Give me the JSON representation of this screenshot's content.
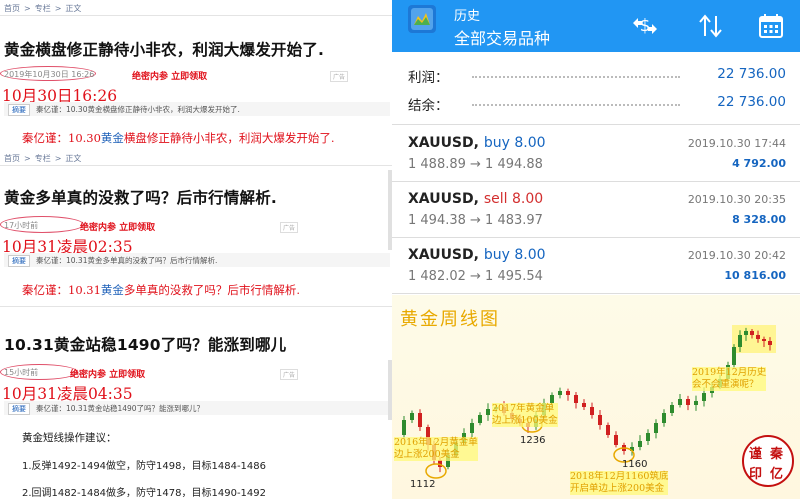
{
  "left": {
    "breadcrumb": [
      "首页",
      ">",
      "专栏",
      ">",
      "正文"
    ],
    "promo": "绝密内参 立即领取",
    "ad_label": "广告",
    "summary_tag": "摘要",
    "articles": [
      {
        "title": "黄金横盘修正静待小非农，利润大爆发开始了.",
        "time": "2019年10月30日 16:26",
        "bigtime": "10月30日16:26",
        "summary": "秦亿谨：10.30黄金横盘修正静待小非农，利润大爆发开始了.",
        "quote_pre": "秦亿谨：10.30",
        "quote_gold": "黄金",
        "quote_post": "横盘修正静待小非农，利润大爆发开始了."
      },
      {
        "title": "黄金多单真的没救了吗？后市行情解析.",
        "time": "17小时前",
        "bigtime": "10月31凌晨02:35",
        "summary": "秦亿谨：10.31黄金多单真的没救了吗？后市行情解析.",
        "quote_pre": "秦亿谨：10.31",
        "quote_gold": "黄金",
        "quote_post": "多单真的没救了吗？后市行情解析."
      },
      {
        "title": "10.31黄金站稳1490了吗？能涨到哪儿",
        "time": "15小时前",
        "bigtime": "10月31凌晨04:35",
        "summary": "秦亿谨：10.31黄金站稳1490了吗？能涨到哪儿？"
      }
    ],
    "advice_title": "黄金短线操作建议：",
    "advice_items": [
      "1.反弹1492-1494做空，防守1498，目标1484-1486",
      "2.回调1482-1484做多，防守1478，目标1490-1492"
    ]
  },
  "right": {
    "appbar": {
      "title": "历史",
      "subtitle": "全部交易品种",
      "icons": [
        "currency-filter-icon",
        "sort-icon",
        "calendar-icon"
      ]
    },
    "summary": {
      "profit_label": "利润：",
      "profit_value": "22 736.00",
      "balance_label": "结余：",
      "balance_value": "22 736.00"
    },
    "trades": [
      {
        "symbol": "XAUUSD,",
        "side": "buy 8.00",
        "prices": "1 488.89 → 1 494.88",
        "time": "2019.10.30 17:44",
        "profit": "4 792.00"
      },
      {
        "symbol": "XAUUSD,",
        "side": "sell 8.00",
        "prices": "1 494.38 → 1 483.97",
        "time": "2019.10.30 20:35",
        "profit": "8 328.00"
      },
      {
        "symbol": "XAUUSD,",
        "side": "buy 8.00",
        "prices": "1 482.02 → 1 495.54",
        "time": "2019.10.30 20:42",
        "profit": "10 816.00"
      }
    ],
    "chart": {
      "title": "黄金周线图",
      "annotations": {
        "a2016": [
          "2016年12月黄金单",
          "边上涨200美金"
        ],
        "a2017": [
          "2017年黄金单",
          "边上涨100美金"
        ],
        "a2018": [
          "2018年12月1160筑底",
          "开启单边上涨200美金"
        ],
        "a2019": [
          "2019年12月历史",
          "会不会重演呢？"
        ]
      },
      "low_labels": [
        "1112",
        "1236",
        "1160"
      ],
      "seal": [
        "谨",
        "秦",
        "印",
        "亿"
      ]
    }
  },
  "chart_data": {
    "type": "candlestick",
    "title": "黄金周线图",
    "labeled_lows": [
      {
        "label": "2016年12月",
        "value": 1112
      },
      {
        "label": "2017年",
        "value": 1236
      },
      {
        "label": "2018年12月",
        "value": 1160
      }
    ],
    "x": [
      "2016-12",
      "2017",
      "2018-12",
      "2019-12"
    ],
    "axis_visible": false
  }
}
